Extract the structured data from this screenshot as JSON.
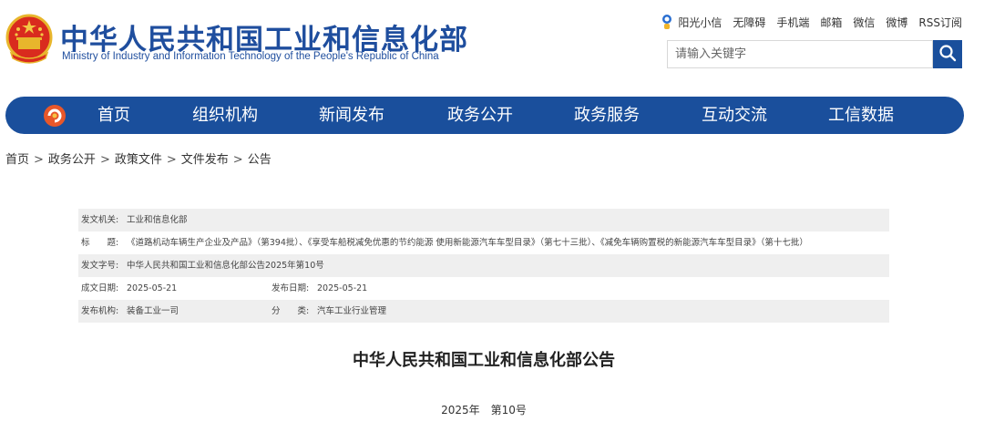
{
  "header": {
    "title_cn": "中华人民共和国工业和信息化部",
    "title_en": "Ministry of Industry and Information Technology of the People's Republic of China",
    "top_links": [
      "阳光小信",
      "无障碍",
      "手机端",
      "邮箱",
      "微信",
      "微博",
      "RSS订阅"
    ],
    "search": {
      "placeholder": "请输入关键字",
      "value": ""
    }
  },
  "nav": {
    "items": [
      "首页",
      "组织机构",
      "新闻发布",
      "政务公开",
      "政务服务",
      "互动交流",
      "工信数据"
    ]
  },
  "breadcrumb": [
    "首页",
    "政务公开",
    "政策文件",
    "文件发布",
    "公告"
  ],
  "breadcrumb_separator": ">",
  "info": {
    "issuer_label": "发文机关:",
    "issuer": "工业和信息化部",
    "subject_label": "标　　题:",
    "subject": "《道路机动车辆生产企业及产品》（第394批）、《享受车船税减免优惠的节约能源 使用新能源汽车车型目录》（第七十三批）、《减免车辆购置税的新能源汽车车型目录》（第十七批）",
    "doc_no_label": "发文字号:",
    "doc_no": "中华人民共和国工业和信息化部公告2025年第10号",
    "created_label": "成文日期:",
    "created": "2025-05-21",
    "published_label": "发布日期:",
    "published": "2025-05-21",
    "org_label": "发布机构:",
    "org": "装备工业一司",
    "category_label": "分　　类:",
    "category": "汽车工业行业管理"
  },
  "article": {
    "title": "中华人民共和国工业和信息化部公告",
    "date_line": "2025年　第10号"
  },
  "colors": {
    "brand_blue": "#1a4f9c",
    "title_blue": "#1f4e9e",
    "row_shade": "#efefef"
  },
  "icons": [
    "national-emblem",
    "sun-mascot-icon",
    "search-icon",
    "miit-logo-icon"
  ]
}
